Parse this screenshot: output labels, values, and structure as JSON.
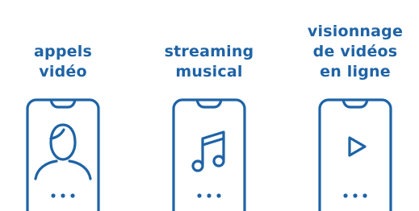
{
  "colors": {
    "accent": "#1e63a6",
    "background": "#ffffff"
  },
  "items": [
    {
      "label": "appels\nvidéo",
      "icon": "person-icon"
    },
    {
      "label": "streaming\nmusical",
      "icon": "music-note-icon"
    },
    {
      "label": "visionnage\nde vidéos\nen ligne",
      "icon": "play-icon"
    }
  ],
  "phone_menu_dots": "..."
}
